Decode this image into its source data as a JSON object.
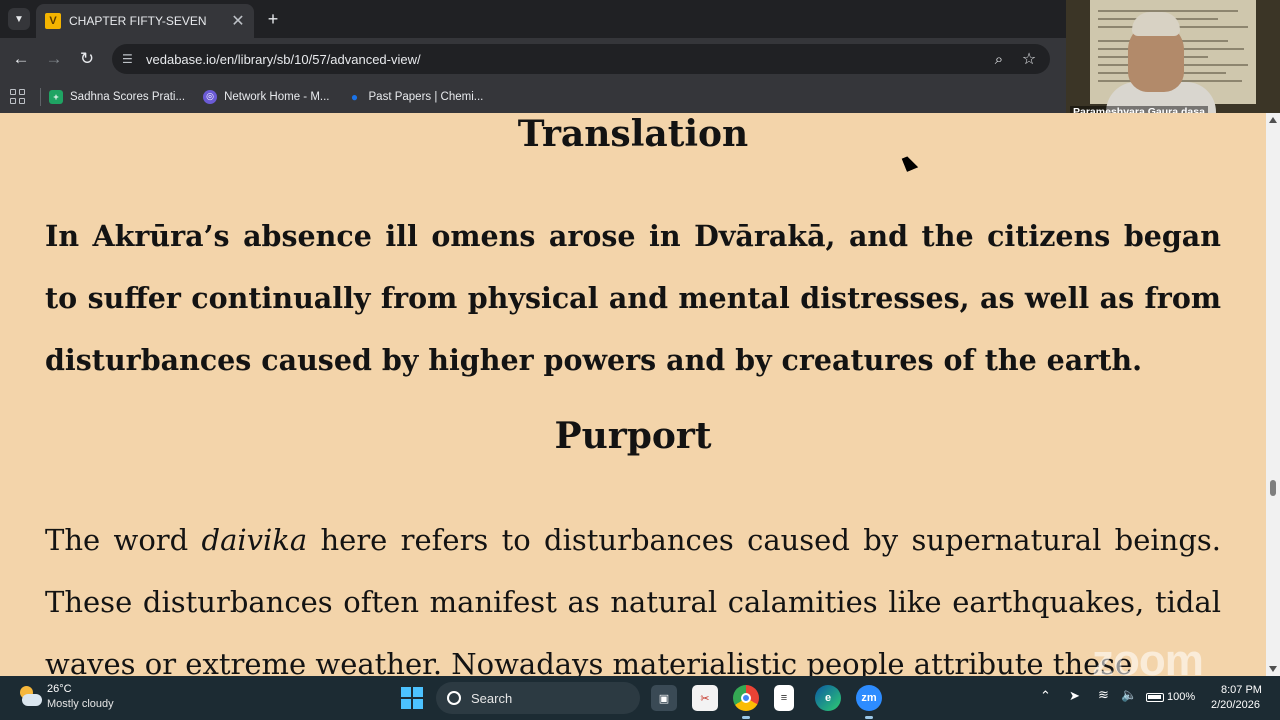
{
  "browser": {
    "tab_title": "CHAPTER FIFTY-SEVEN",
    "tab_favicon_letter": "V",
    "url": "vedabase.io/en/library/sb/10/57/advanced-view/",
    "bookmarks": [
      {
        "label": "Sadhna Scores Prati...",
        "icon_color": "#1fa463",
        "icon": "plus-icon"
      },
      {
        "label": "Network Home - M...",
        "icon_color": "#6b5bd6",
        "icon": "network-icon"
      },
      {
        "label": "Past Papers | Chemi...",
        "icon_color": "#1a73e8",
        "icon": "drop-icon"
      }
    ]
  },
  "video": {
    "participant_name": "Parameshvara Gaura dasa"
  },
  "content": {
    "translation_heading": "Translation",
    "translation_text": "In Akrūra’s absence ill omens arose in Dvārakā, and the citizens began to suffer continually from physical and mental distresses, as well as from disturbances caused by higher powers and by creatures of the earth.",
    "purport_heading": "Purport",
    "purport_pre": "The word ",
    "purport_italic": "daivika",
    "purport_post": " here refers to disturbances caused by supernatural beings. These disturbances often manifest as natural calamities like earthquakes, tidal waves or extreme weather. Nowadays materialistic people attribute these",
    "background_color": "#f3d4aa"
  },
  "watermark": "zoom",
  "taskbar": {
    "temperature": "26°C",
    "weather": "Mostly cloudy",
    "search_placeholder": "Search",
    "battery": "100%",
    "time": "8:07 PM",
    "date": "2/20/2026",
    "apps": [
      "file-explorer-icon",
      "snipping-tool-icon",
      "chrome-icon",
      "notepad-icon",
      "edge-icon",
      "zoom-icon"
    ]
  }
}
